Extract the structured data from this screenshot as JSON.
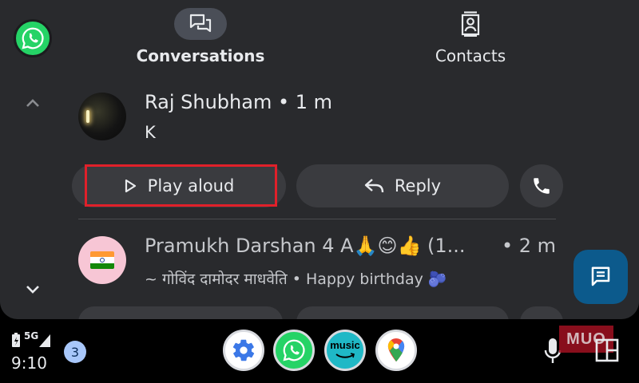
{
  "tabs": {
    "conversations": "Conversations",
    "contacts": "Contacts"
  },
  "messages": [
    {
      "sender_line": "Raj Shubham • 1 m",
      "preview": "K"
    },
    {
      "sender": "Pramukh Darshan 4 A🙏😊👍 (1...",
      "time": "• 2 m",
      "preview": "~ गोविंद  दामोदर माधवेति • Happy birthday 🫐"
    }
  ],
  "actions": {
    "play_aloud": "Play aloud",
    "reply": "Reply"
  },
  "taskbar": {
    "network": "5G",
    "time": "9:10",
    "notification_count": "3",
    "music_label_top": "music",
    "watermark": "MUO"
  },
  "icons": [
    "whatsapp-icon",
    "conversations-icon",
    "contacts-icon",
    "chevron-up-icon",
    "chevron-down-icon",
    "play-icon",
    "reply-icon",
    "phone-icon",
    "new-message-icon",
    "settings-icon",
    "maps-icon",
    "mic-icon",
    "layout-icon",
    "battery-icon",
    "signal-icon"
  ],
  "colors": {
    "background": "#292a2d",
    "button": "#3a3b3f",
    "highlight": "#e0202a",
    "fab": "#0c5a8c",
    "whatsapp": "#25d366"
  }
}
